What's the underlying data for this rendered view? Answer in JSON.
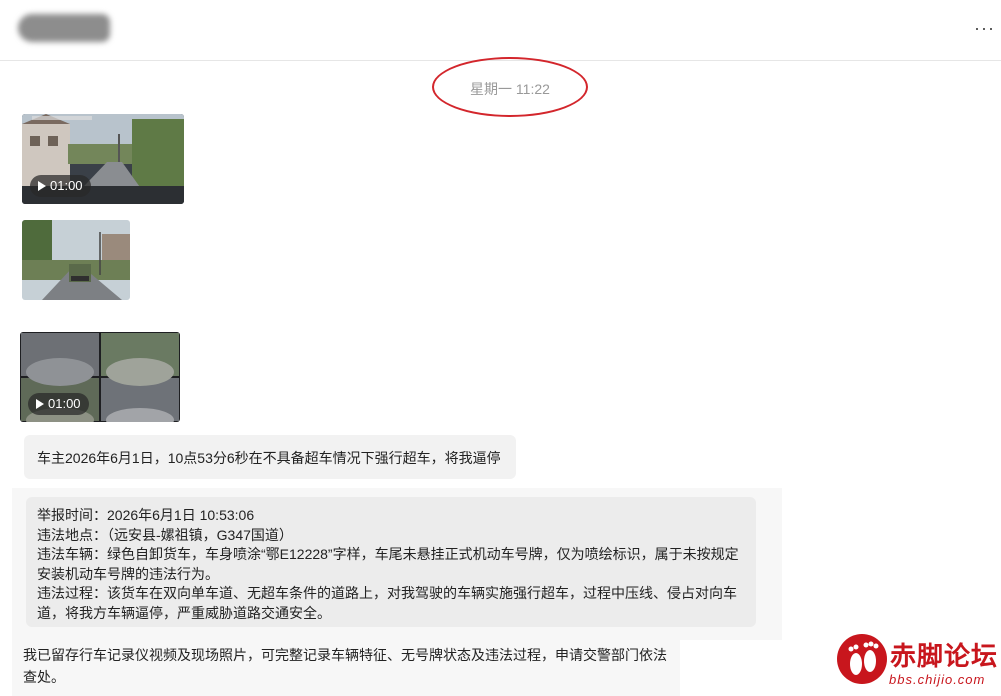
{
  "header": {
    "contact_name": "",
    "more_label": "···"
  },
  "timestamp": "星期一 11:22",
  "messages": {
    "video1": {
      "duration": "01:00"
    },
    "video2": {
      "duration": "01:00"
    },
    "text1": "车主2026年6月1日，10点53分6秒在不具备超车情况下强行超车，将我逼停",
    "quote": {
      "line1": "举报时间：2026年6月1日 10:53:06",
      "line2": "违法地点：（远安县-嫘祖镇，G347国道）",
      "line3": "违法车辆：绿色自卸货车，车身喷涂“鄂E12228”字样，车尾未悬挂正式机动车号牌，仅为喷绘标识，属于未按规定安装机动车号牌的违法行为。",
      "line4": "违法过程：该货车在双向单车道、无超车条件的道路上，对我驾驶的车辆实施强行超车，过程中压线、侵占对向车道，将我方车辆逼停，严重威胁道路交通安全。"
    },
    "text2": "我已留存行车记录仪视频及现场照片，可完整记录车辆特征、无号牌状态及违法过程，申请交警部门依法查处。"
  },
  "watermark": {
    "name": "赤脚论坛",
    "url": "bbs.chijio.com"
  },
  "colors": {
    "annotation_red": "#d3262c",
    "logo_red": "#c8161d"
  }
}
